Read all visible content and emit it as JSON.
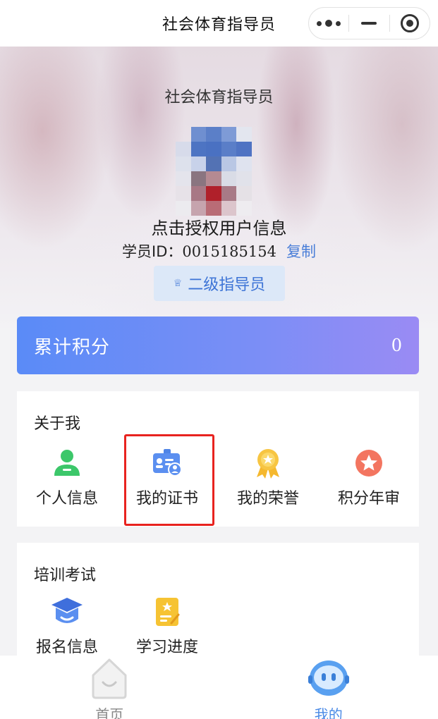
{
  "navbar": {
    "title": "社会体育指导员",
    "menu_icon": "more-dots-icon",
    "minimize_icon": "minimize-icon",
    "close_icon": "target-close-icon"
  },
  "profile": {
    "app_title": "社会体育指导员",
    "user_name": "点击授权用户信息",
    "student_id_label": "学员ID：",
    "student_id": "0015185154",
    "copy_label": "复制",
    "level_badge": "二级指导员",
    "level_icon": "crown-icon"
  },
  "points": {
    "label": "累计积分",
    "value": "0"
  },
  "about_section": {
    "title": "关于我",
    "items": [
      {
        "label": "个人信息",
        "icon": "person-icon"
      },
      {
        "label": "我的证书",
        "icon": "certificate-icon"
      },
      {
        "label": "我的荣誉",
        "icon": "medal-icon"
      },
      {
        "label": "积分年审",
        "icon": "star-badge-icon"
      }
    ]
  },
  "training_section": {
    "title": "培训考试",
    "items": [
      {
        "label": "报名信息",
        "icon": "graduation-cap-icon"
      },
      {
        "label": "学习进度",
        "icon": "study-progress-icon"
      }
    ]
  },
  "tabbar": {
    "items": [
      {
        "label": "首页",
        "icon": "home-icon"
      },
      {
        "label": "我的",
        "icon": "robot-face-icon"
      }
    ]
  },
  "colors": {
    "accent_blue": "#4a8ae6",
    "highlight_red": "#e8231f",
    "points_gradient_start": "#5a8bf7",
    "points_gradient_end": "#9a8bf4"
  }
}
